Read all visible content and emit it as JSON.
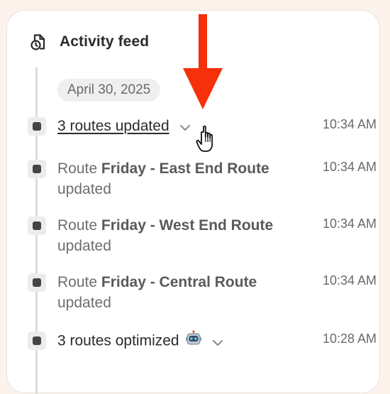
{
  "header": {
    "title": "Activity feed",
    "icon": "activity-feed-icon"
  },
  "date_group": "April 30, 2025",
  "items": [
    {
      "text": "3 routes updated",
      "time": "10:34 AM",
      "expandable": true
    },
    {
      "prefix": "Route ",
      "route_name": "Friday - East End Route",
      "suffix": "updated",
      "time": "10:34 AM"
    },
    {
      "prefix": "Route ",
      "route_name": "Friday - West End Route",
      "suffix": "updated",
      "time": "10:34 AM"
    },
    {
      "prefix": "Route ",
      "route_name": "Friday - Central Route",
      "suffix": "updated",
      "time": "10:34 AM"
    },
    {
      "text": "3 routes optimized",
      "emoji": "robot-icon",
      "time": "10:28 AM",
      "expandable": true
    }
  ],
  "colors": {
    "page_background": "#fdf3ec",
    "card_background": "#ffffff",
    "annotation_arrow": "#f5300a"
  }
}
